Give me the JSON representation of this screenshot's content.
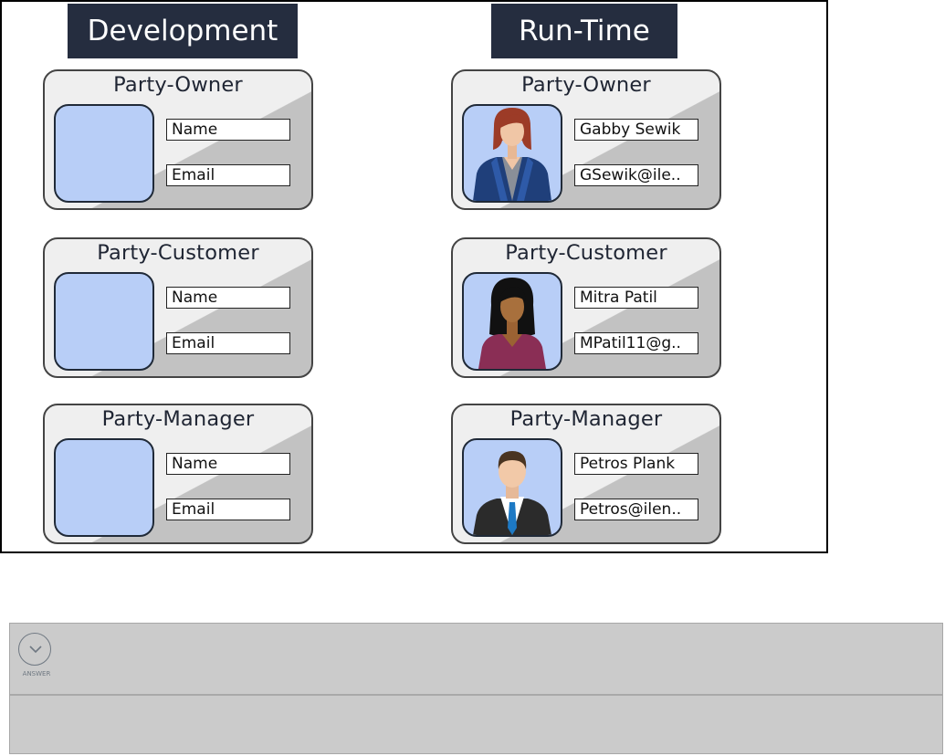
{
  "headers": {
    "development": "Development",
    "runtime": "Run-Time"
  },
  "development": {
    "cards": [
      {
        "title": "Party-Owner",
        "field1": "Name",
        "field2": "Email"
      },
      {
        "title": "Party-Customer",
        "field1": "Name",
        "field2": "Email"
      },
      {
        "title": "Party-Manager",
        "field1": "Name",
        "field2": "Email"
      }
    ]
  },
  "runtime": {
    "cards": [
      {
        "title": "Party-Owner",
        "field1": "Gabby Sewik",
        "field2": "GSewik@ile..",
        "avatar": "woman-redhead-avatar-icon"
      },
      {
        "title": "Party-Customer",
        "field1": "Mitra Patil",
        "field2": "MPatil11@g..",
        "avatar": "woman-avatar-icon"
      },
      {
        "title": "Party-Manager",
        "field1": "Petros Plank",
        "field2": "Petros@ilen..",
        "avatar": "man-avatar-icon"
      }
    ]
  },
  "answer": {
    "label": "ANSWER",
    "icon": "chevron-down-icon"
  },
  "colors": {
    "header_bg": "#252d3f",
    "photo_bg": "#b8cef7",
    "card_light": "#efefef",
    "card_dark": "#c2c2c2",
    "panel_bg": "#cbcbcb"
  }
}
